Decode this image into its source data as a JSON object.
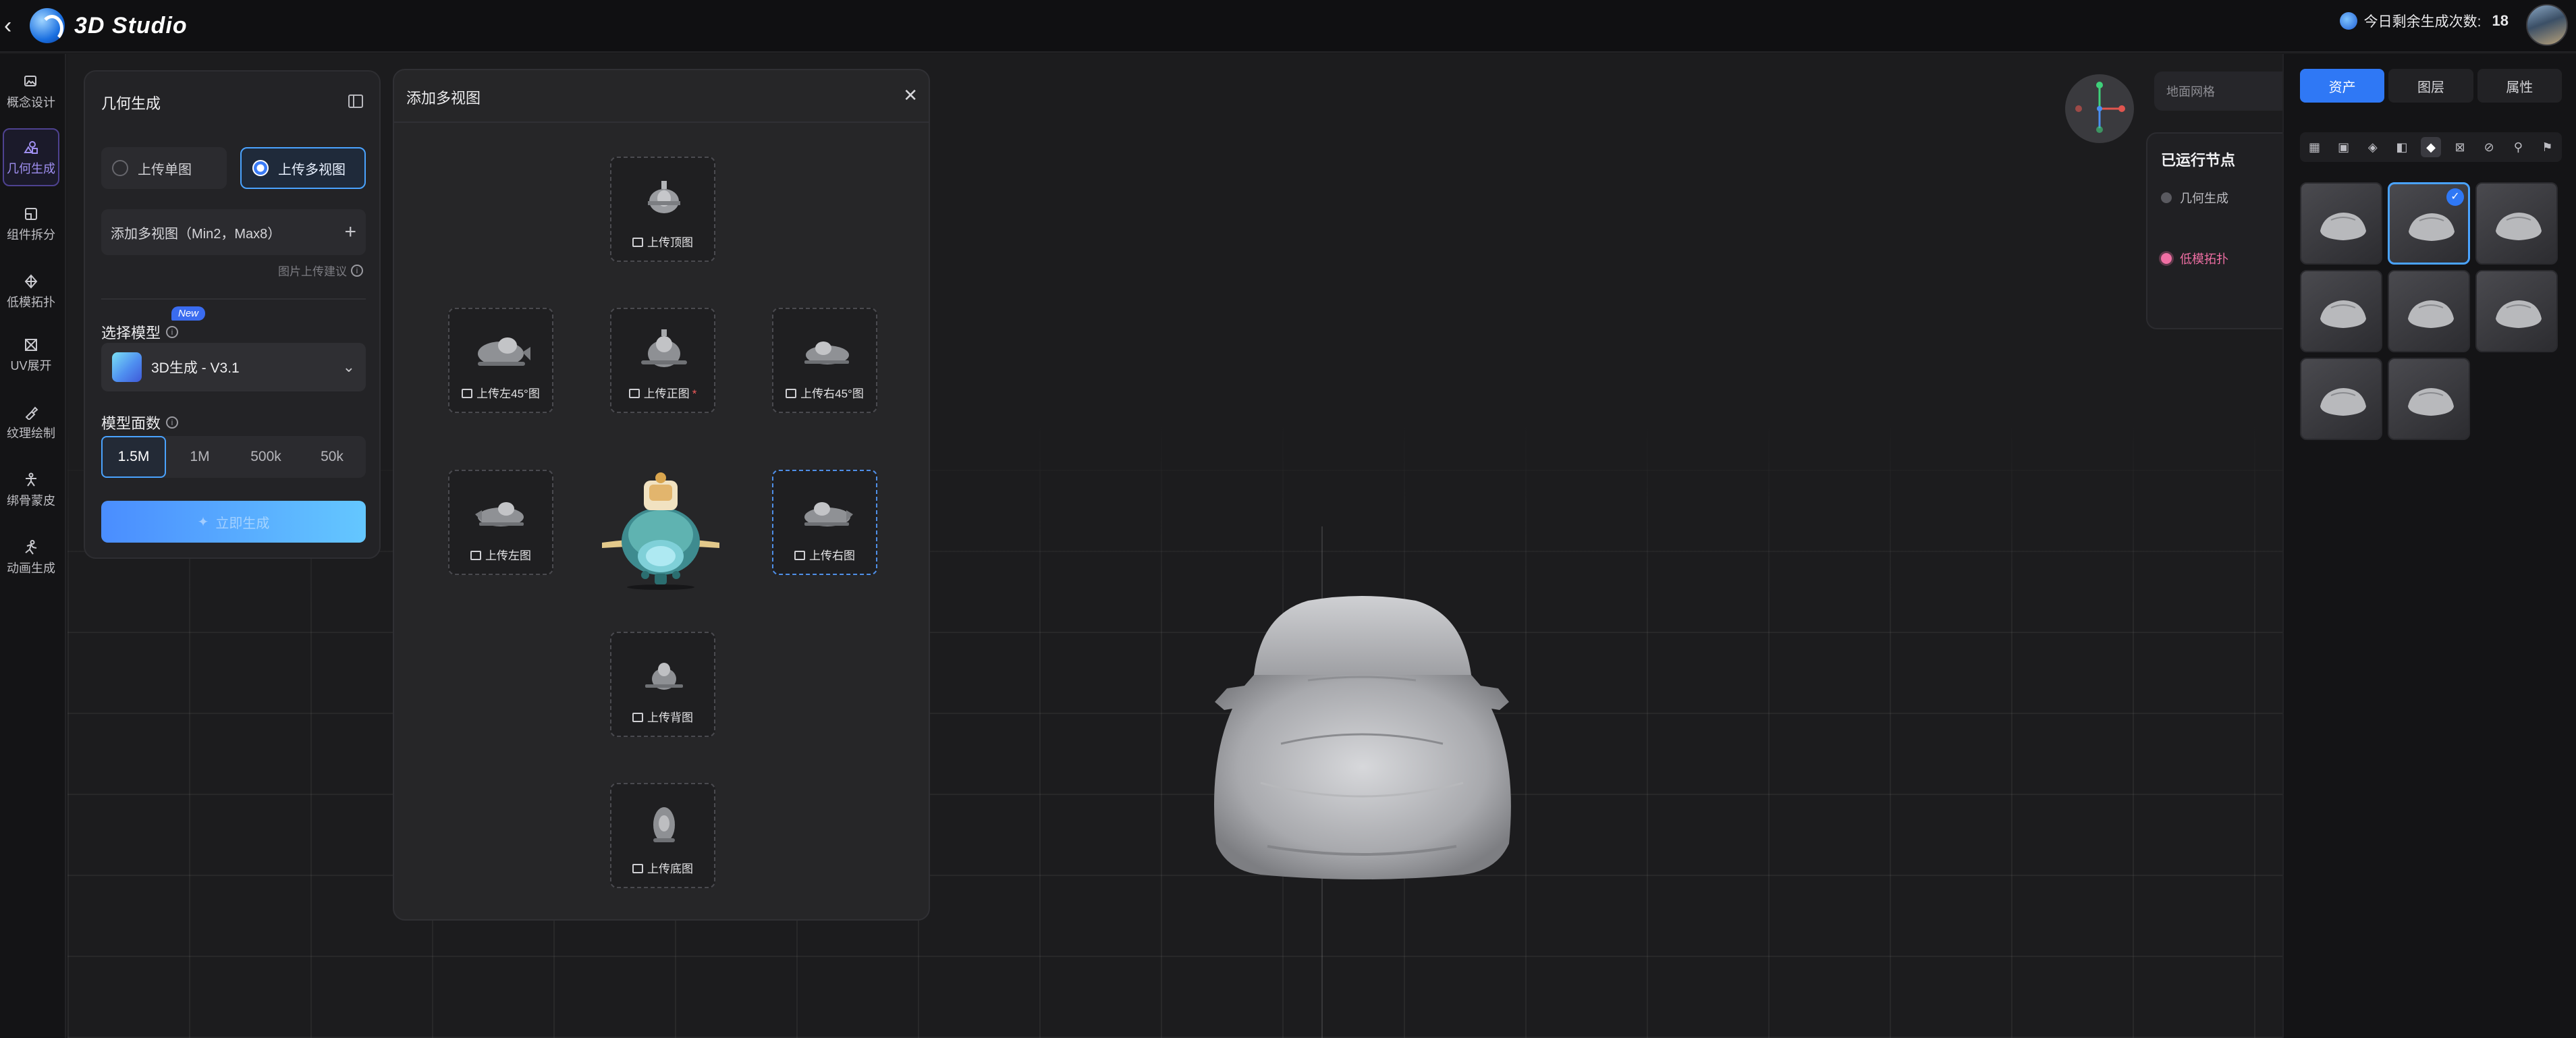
{
  "header": {
    "back_icon": "chevron-left-icon",
    "app_title": "3D Studio",
    "credits_label": "今日剩余生成次数:",
    "credits_count": "18"
  },
  "sidebar": {
    "items": [
      {
        "label": "概念设计",
        "icon": "image-edit-icon"
      },
      {
        "label": "几何生成",
        "icon": "shapes-icon",
        "active": true
      },
      {
        "label": "组件拆分",
        "icon": "split-icon"
      },
      {
        "label": "低模拓扑",
        "icon": "mesh-icon"
      },
      {
        "label": "UV展开",
        "icon": "uv-icon"
      },
      {
        "label": "纹理绘制",
        "icon": "brush-icon"
      },
      {
        "label": "绑骨蒙皮",
        "icon": "skeleton-icon"
      },
      {
        "label": "动画生成",
        "icon": "run-icon"
      }
    ]
  },
  "geometry_panel": {
    "title": "几何生成",
    "mode_single": "上传单图",
    "mode_multi": "上传多视图",
    "add_multi": "添加多视图（Min2，Max8）",
    "upload_tip": "图片上传建议",
    "model_label": "选择模型",
    "new_badge": "New",
    "model_value": "3D生成 - V3.1",
    "faces_label": "模型面数",
    "faces": [
      "1.5M",
      "1M",
      "500k",
      "50k"
    ],
    "faces_selected": "1.5M",
    "generate": "立即生成"
  },
  "multiview_modal": {
    "title": "添加多视图",
    "slots": {
      "top": "上传顶图",
      "left45": "上传左45°图",
      "front": "上传正图",
      "front_required": "*",
      "right45": "上传右45°图",
      "left": "上传左图",
      "right": "上传右图",
      "back": "上传背图",
      "bottom": "上传底图"
    }
  },
  "viewport": {
    "ground_grid_label": "地面网格",
    "ground_grid_on": true,
    "run_nodes_title": "已运行节点",
    "run_nodes": [
      {
        "label": "几何生成",
        "active": false
      },
      {
        "label": "低模拓扑",
        "active": true
      }
    ]
  },
  "right_panel": {
    "tabs": [
      "资产",
      "图层",
      "属性"
    ],
    "active_tab": "资产",
    "filter_icons": [
      "grid-icon",
      "image-icon",
      "shapes-icon",
      "split-icon",
      "mesh-icon",
      "uv-icon",
      "brush-icon",
      "skeleton-icon",
      "run-icon"
    ],
    "asset_count": 8,
    "selected_asset": 2
  },
  "colors": {
    "accent": "#2f78f5",
    "active_nav": "#9f8ff0",
    "node_active": "#f06fa4",
    "background": "#1a1a1c"
  }
}
